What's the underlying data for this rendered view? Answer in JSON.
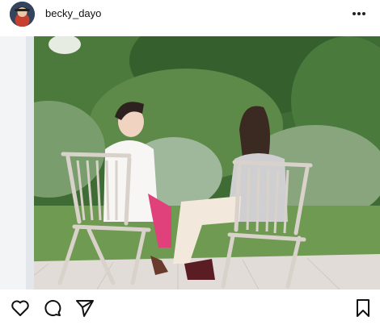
{
  "post": {
    "username": "becky_dayo"
  },
  "icons": {
    "more": "more-horizontal-icon",
    "like": "heart-icon",
    "comment": "comment-bubble-icon",
    "share": "paper-plane-icon",
    "save": "bookmark-icon"
  },
  "colors": {
    "text": "#111111",
    "background": "#ffffff"
  }
}
